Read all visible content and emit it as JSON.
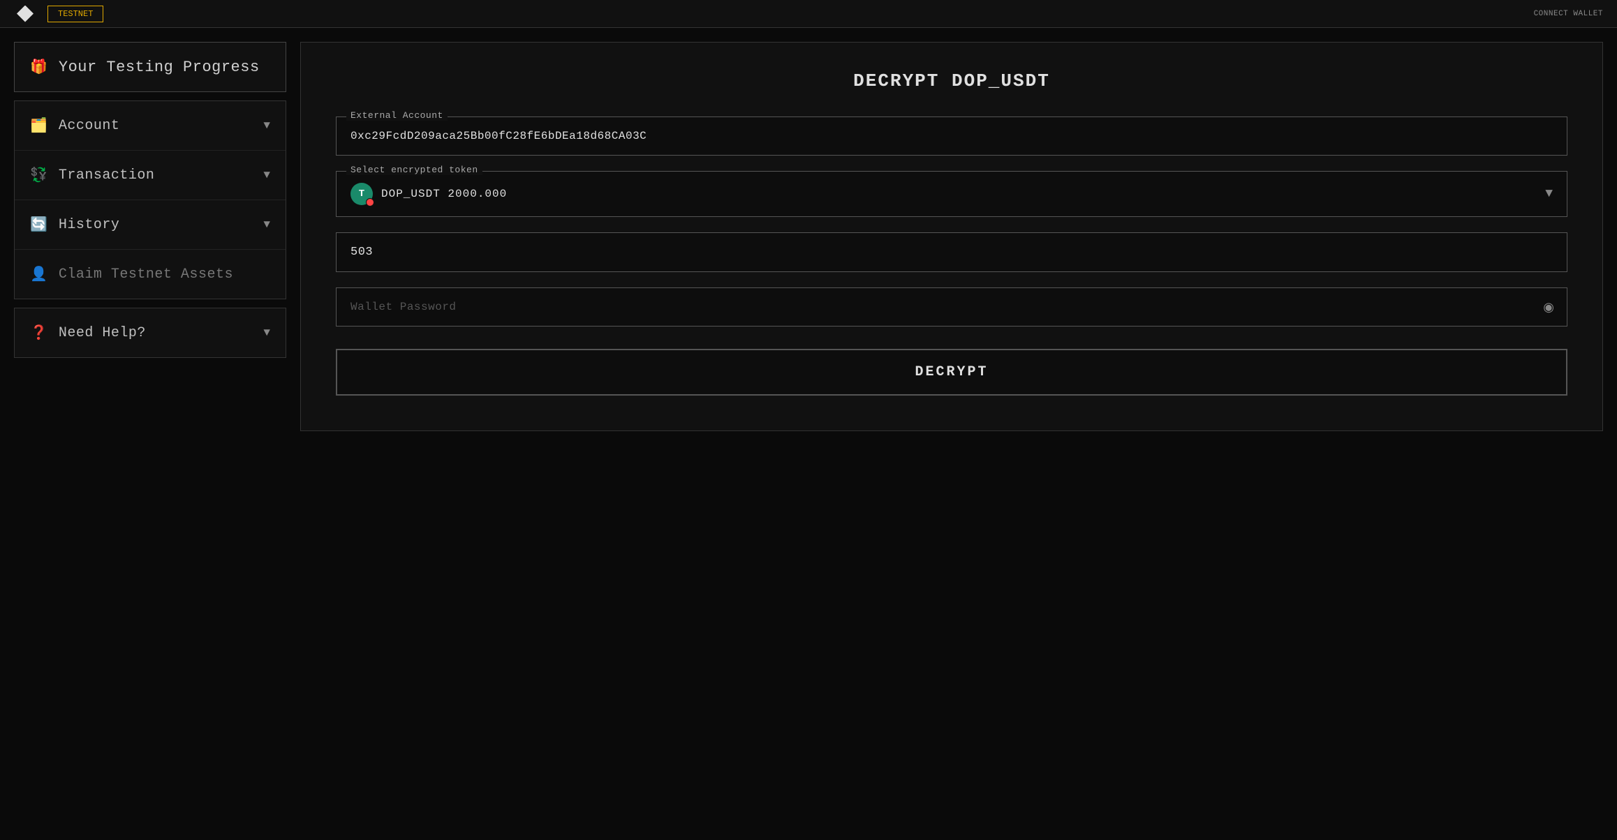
{
  "topbar": {
    "nav_items": [
      {
        "label": "TESTNET",
        "active": true
      }
    ],
    "right_text": "CONNECT WALLET"
  },
  "sidebar": {
    "testing_progress": {
      "label": "Your Testing Progress",
      "icon": "🎁"
    },
    "items": [
      {
        "label": "Account",
        "icon": "🗂️",
        "has_chevron": true
      },
      {
        "label": "Transaction",
        "icon": "💱",
        "has_chevron": true
      },
      {
        "label": "History",
        "icon": "🔄",
        "has_chevron": true
      },
      {
        "label": "Claim Testnet Assets",
        "icon": "👤",
        "has_chevron": false
      }
    ],
    "help": {
      "label": "Need Help?",
      "icon": "❓",
      "has_chevron": true
    }
  },
  "form": {
    "title": "DECRYPT DOP_USDT",
    "external_account_label": "External Account",
    "external_account_value": "0xc29FcdD209aca25Bb00fC28fE6bDEa18d68CA03C",
    "select_token_label": "Select encrypted token",
    "token_icon_letter": "T",
    "token_name": "DOP_USDT  2000.000",
    "amount_value": "503",
    "password_placeholder": "Wallet Password",
    "decrypt_button": "DECRYPT"
  },
  "icons": {
    "chevron_down": "▼",
    "eye": "◉"
  }
}
